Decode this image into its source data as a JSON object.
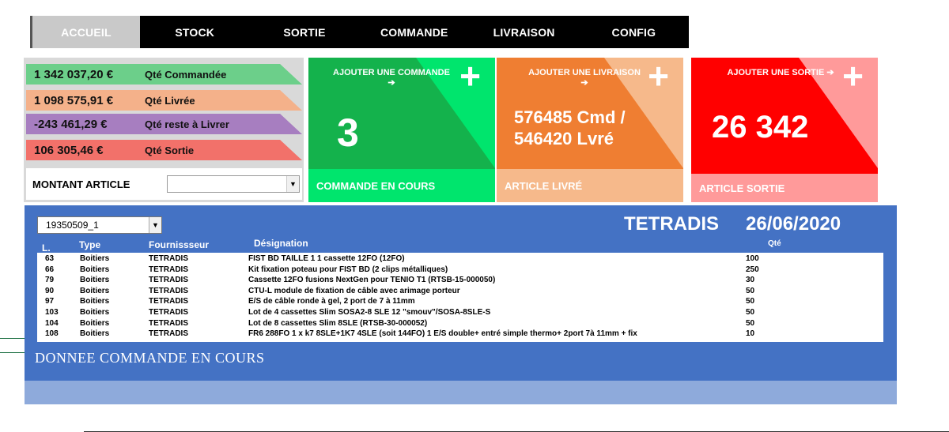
{
  "nav": {
    "tabs": [
      {
        "label": "ACCUEIL",
        "active": true
      },
      {
        "label": "STOCK"
      },
      {
        "label": "SORTIE"
      },
      {
        "label": "COMMANDE"
      },
      {
        "label": "LIVRAISON"
      },
      {
        "label": "CONFIG"
      }
    ]
  },
  "summary": {
    "ordered_amount": "1 342 037,20 €",
    "ordered_label": "Qté Commandée",
    "delivered_amount": "1 098 575,91 €",
    "delivered_label": "Qté Livrée",
    "remaining_amount": "-243 461,29 €",
    "remaining_label": "Qté reste à Livrer",
    "out_amount": "106 305,46 €",
    "out_label": "Qté Sortie",
    "montant_label": "MONTANT ARTICLE"
  },
  "cards": {
    "commande": {
      "add_label": "AJOUTER UNE COMMANDE ➔",
      "value": "3",
      "footer": "COMMANDE EN COURS"
    },
    "livraison": {
      "add_label": "AJOUTER UNE LIVRAISON ➔",
      "value_line1": "576485 Cmd /",
      "value_line2": "546420 Lvré",
      "footer": "ARTICLE LIVRÉ"
    },
    "sortie": {
      "add_label": "AJOUTER UNE SORTIE ➔",
      "value": "26 342",
      "footer": "ARTICLE SORTIE"
    }
  },
  "plus_glyph": "+",
  "panel": {
    "order_select": "19350509_1",
    "company": "TETRADIS",
    "date": "26/06/2020",
    "headers": {
      "l": "L.",
      "type": "Type",
      "fournisseur": "Fournissseur",
      "designation": "Désignation",
      "qte": "Qté"
    },
    "rows": [
      {
        "l": "63",
        "type": "Boitiers",
        "fournisseur": "TETRADIS",
        "designation": "FIST BD TAILLE  1 1 cassette 12FO (12FO)",
        "qte": "100"
      },
      {
        "l": "66",
        "type": "Boitiers",
        "fournisseur": "TETRADIS",
        "designation": "Kit fixation poteau pour FIST BD (2 clips métalliques)",
        "qte": "250"
      },
      {
        "l": "79",
        "type": "Boitiers",
        "fournisseur": "TETRADIS",
        "designation": "Cassette 12FO fusions NextGen pour TENIO T1 (RTSB-15-000050)",
        "qte": "30"
      },
      {
        "l": "90",
        "type": "Boitiers",
        "fournisseur": "TETRADIS",
        "designation": "CTU-L module de fixation de câble avec arimage porteur",
        "qte": "50"
      },
      {
        "l": "97",
        "type": "Boitiers",
        "fournisseur": "TETRADIS",
        "designation": "E/S de câble ronde à gel, 2 port de 7 à 11mm",
        "qte": "50"
      },
      {
        "l": "103",
        "type": "Boitiers",
        "fournisseur": "TETRADIS",
        "designation": "Lot de 4 cassettes Slim SOSA2-8 SLE 12 \"smouv\"/SOSA-8SLE-S",
        "qte": "50"
      },
      {
        "l": "104",
        "type": "Boitiers",
        "fournisseur": "TETRADIS",
        "designation": "Lot de 8 cassettes Slim 8SLE (RTSB-30-000052)",
        "qte": "50"
      },
      {
        "l": "108",
        "type": "Boitiers",
        "fournisseur": "TETRADIS",
        "designation": "FR6 288FO 1 x k7 8SLE+1K7 4SLE (soit 144FO) 1 E/S double+ entré simple thermo+ 2port 7à 11mm + fix",
        "qte": "10"
      }
    ],
    "section_title": "DONNEE COMMANDE EN COURS"
  }
}
